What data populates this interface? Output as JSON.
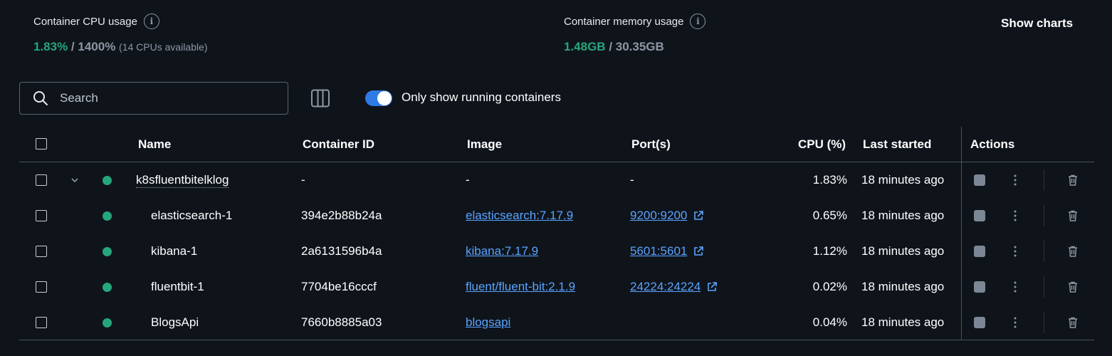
{
  "stats": {
    "cpu": {
      "title": "Container CPU usage",
      "used": "1.83%",
      "sep": " / ",
      "total": "1400%",
      "note": "(14 CPUs available)"
    },
    "memory": {
      "title": "Container memory usage",
      "used": "1.48GB",
      "sep": " / ",
      "total": "30.35GB"
    },
    "info_glyph": "i",
    "show_charts": "Show charts"
  },
  "toolbar": {
    "search_placeholder": "Search",
    "toggle_label": "Only show running containers",
    "toggle_on": true
  },
  "table": {
    "headers": {
      "name": "Name",
      "container_id": "Container ID",
      "image": "Image",
      "ports": "Port(s)",
      "cpu": "CPU (%)",
      "last_started": "Last started",
      "actions": "Actions"
    },
    "rows": [
      {
        "name": "k8sfluentbitelklog",
        "id": "-",
        "image": "-",
        "ports": "-",
        "cpu": "1.83%",
        "last_started": "18 minutes ago"
      },
      {
        "name": "elasticsearch-1",
        "id": "394e2b88b24a",
        "image": "elasticsearch:7.17.9",
        "ports": "9200:9200",
        "cpu": "0.65%",
        "last_started": "18 minutes ago"
      },
      {
        "name": "kibana-1",
        "id": "2a6131596b4a",
        "image": "kibana:7.17.9",
        "ports": "5601:5601",
        "cpu": "1.12%",
        "last_started": "18 minutes ago"
      },
      {
        "name": "fluentbit-1",
        "id": "7704be16cccf",
        "image": "fluent/fluent-bit:2.1.9",
        "ports": "24224:24224",
        "cpu": "0.02%",
        "last_started": "18 minutes ago"
      },
      {
        "name": "BlogsApi",
        "id": "7660b8885a03",
        "image": "blogsapi",
        "ports": "",
        "cpu": "0.04%",
        "last_started": "18 minutes ago"
      }
    ]
  },
  "colors": {
    "background": "#0f141b",
    "running": "#26a67c",
    "link": "#5aa3ff",
    "toggle": "#2f7be5"
  },
  "icons": [
    "info-icon",
    "search-icon",
    "columns-icon",
    "chevron-down-icon",
    "status-running-icon",
    "external-link-icon",
    "stop-icon",
    "more-vertical-icon",
    "trash-icon"
  ]
}
